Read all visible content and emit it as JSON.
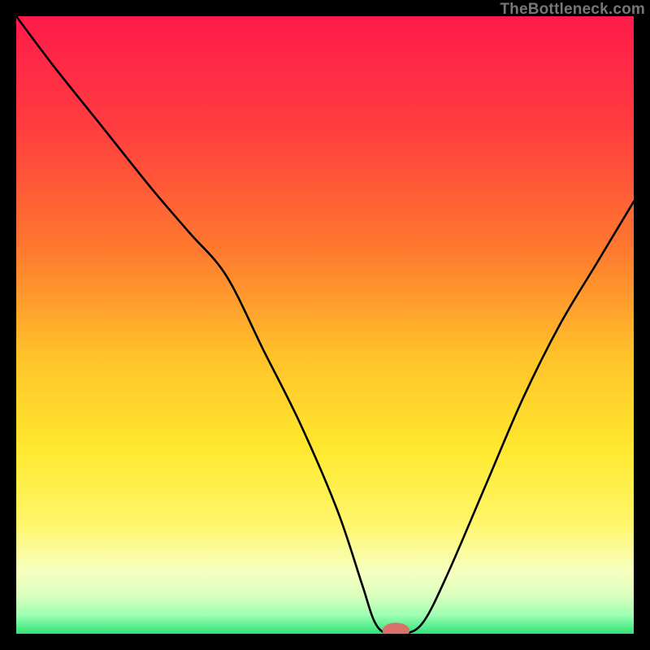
{
  "watermark": "TheBottleneck.com",
  "chart_data": {
    "type": "line",
    "title": "",
    "xlabel": "",
    "ylabel": "",
    "xlim": [
      0,
      100
    ],
    "ylim": [
      0,
      100
    ],
    "gradient_stops": [
      {
        "offset": 0,
        "color": "#ff1a4b"
      },
      {
        "offset": 18,
        "color": "#ff3d3f"
      },
      {
        "offset": 38,
        "color": "#ff7a2e"
      },
      {
        "offset": 55,
        "color": "#ffc22a"
      },
      {
        "offset": 70,
        "color": "#ffe82e"
      },
      {
        "offset": 82,
        "color": "#fff66a"
      },
      {
        "offset": 90,
        "color": "#f6ffc0"
      },
      {
        "offset": 94,
        "color": "#d8ffbe"
      },
      {
        "offset": 97,
        "color": "#9dffb3"
      },
      {
        "offset": 100,
        "color": "#31e27a"
      }
    ],
    "series": [
      {
        "name": "bottleneck-curve",
        "x": [
          0,
          6,
          14,
          22,
          28,
          34,
          40,
          46,
          52,
          56,
          58,
          60,
          63,
          66,
          70,
          76,
          82,
          88,
          94,
          100
        ],
        "y": [
          100,
          92,
          82,
          72,
          65,
          58,
          46,
          34,
          20,
          8,
          2,
          0,
          0,
          2,
          10,
          24,
          38,
          50,
          60,
          70
        ]
      }
    ],
    "marker": {
      "x": 61.5,
      "y": 0.5,
      "rx": 2.2,
      "ry": 1.3,
      "color": "#d9716a"
    }
  }
}
